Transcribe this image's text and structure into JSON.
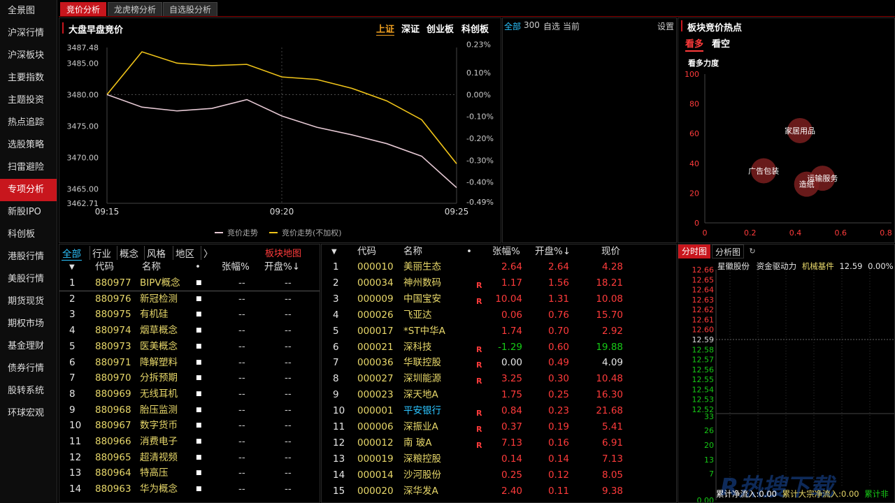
{
  "nav": [
    "全景图",
    "沪深行情",
    "沪深板块",
    "主要指数",
    "主题投资",
    "热点追踪",
    "选股策略",
    "扫雷避险",
    "专项分析",
    "新股IPO",
    "科创板",
    "港股行情",
    "美股行情",
    "期货现货",
    "期权市场",
    "基金理财",
    "债券行情",
    "股转系统",
    "环球宏观"
  ],
  "nav_active": 8,
  "tabs": [
    "竞价分析",
    "龙虎榜分析",
    "自选股分析"
  ],
  "auction": {
    "title": "大盘早盘竞价",
    "markets": [
      "上证",
      "深证",
      "创业板",
      "科创板"
    ],
    "active_market": 0,
    "legend": [
      "竞价走势",
      "竞价走势(不加权)"
    ]
  },
  "mid_toolbar": {
    "all": "全部",
    "count": "300",
    "watch": "自选",
    "current": "当前",
    "settings": "设置"
  },
  "hot": {
    "title": "板块竞价热点",
    "tabs": [
      "看多",
      "看空"
    ],
    "active_tab": 0,
    "subtitle": "看多力度"
  },
  "sector_filters": [
    "全部",
    "行业",
    "概念",
    "风格",
    "地区",
    "〉"
  ],
  "sector_map_label": "板块地图",
  "sector_headers": {
    "code": "代码",
    "name": "名称",
    "dot": "•",
    "change": "张幅%",
    "open": "开盘%↓"
  },
  "sectors": [
    [
      "1",
      "880977",
      "BIPV概念",
      "--",
      "--"
    ],
    [
      "2",
      "880976",
      "新冠检测",
      "--",
      "--"
    ],
    [
      "3",
      "880975",
      "有机硅",
      "--",
      "--"
    ],
    [
      "4",
      "880974",
      "烟草概念",
      "--",
      "--"
    ],
    [
      "5",
      "880973",
      "医美概念",
      "--",
      "--"
    ],
    [
      "6",
      "880971",
      "降解塑料",
      "--",
      "--"
    ],
    [
      "7",
      "880970",
      "分拆预期",
      "--",
      "--"
    ],
    [
      "8",
      "880969",
      "无线耳机",
      "--",
      "--"
    ],
    [
      "9",
      "880968",
      "胎压监测",
      "--",
      "--"
    ],
    [
      "10",
      "880967",
      "数字货币",
      "--",
      "--"
    ],
    [
      "11",
      "880966",
      "消费电子",
      "--",
      "--"
    ],
    [
      "12",
      "880965",
      "超清视频",
      "--",
      "--"
    ],
    [
      "13",
      "880964",
      "特高压",
      "--",
      "--"
    ],
    [
      "14",
      "880963",
      "华为概念",
      "--",
      "--"
    ]
  ],
  "stock_headers": {
    "code": "代码",
    "name": "名称",
    "dot": "•",
    "change": "张幅%",
    "open": "开盘%↓",
    "price": "现价"
  },
  "stocks": [
    {
      "no": "1",
      "code": "000010",
      "name": "美丽生态",
      "r": "",
      "chg": "2.64",
      "open": "2.64",
      "price": "4.28",
      "c": "red",
      "nc": "yellow"
    },
    {
      "no": "2",
      "code": "000034",
      "name": "神州数码",
      "r": "R",
      "chg": "1.17",
      "open": "1.56",
      "price": "18.21",
      "c": "red",
      "nc": "yellow"
    },
    {
      "no": "3",
      "code": "000009",
      "name": "中国宝安",
      "r": "R",
      "chg": "10.04",
      "open": "1.31",
      "price": "10.08",
      "c": "red",
      "nc": "yellow"
    },
    {
      "no": "4",
      "code": "000026",
      "name": "飞亚达",
      "r": "",
      "chg": "0.06",
      "open": "0.76",
      "price": "15.70",
      "c": "red",
      "nc": "yellow"
    },
    {
      "no": "5",
      "code": "000017",
      "name": "*ST中华A",
      "r": "",
      "chg": "1.74",
      "open": "0.70",
      "price": "2.92",
      "c": "red",
      "nc": "yellow"
    },
    {
      "no": "6",
      "code": "000021",
      "name": "深科技",
      "r": "R",
      "chg": "-1.29",
      "open": "0.60",
      "price": "19.88",
      "c": "green",
      "nc": "yellow"
    },
    {
      "no": "7",
      "code": "000036",
      "name": "华联控股",
      "r": "R",
      "chg": "0.00",
      "open": "0.49",
      "price": "4.09",
      "c": "white",
      "nc": "yellow"
    },
    {
      "no": "8",
      "code": "000027",
      "name": "深圳能源",
      "r": "R",
      "chg": "3.25",
      "open": "0.30",
      "price": "10.48",
      "c": "red",
      "nc": "yellow"
    },
    {
      "no": "9",
      "code": "000023",
      "name": "深天地A",
      "r": "",
      "chg": "1.75",
      "open": "0.25",
      "price": "16.30",
      "c": "red",
      "nc": "yellow"
    },
    {
      "no": "10",
      "code": "000001",
      "name": "平安银行",
      "r": "R",
      "chg": "0.84",
      "open": "0.23",
      "price": "21.68",
      "c": "red",
      "nc": "cyan"
    },
    {
      "no": "11",
      "code": "000006",
      "name": "深振业A",
      "r": "R",
      "chg": "0.37",
      "open": "0.19",
      "price": "5.41",
      "c": "red",
      "nc": "yellow"
    },
    {
      "no": "12",
      "code": "000012",
      "name": "南 玻A",
      "r": "R",
      "chg": "7.13",
      "open": "0.16",
      "price": "6.91",
      "c": "red",
      "nc": "yellow"
    },
    {
      "no": "13",
      "code": "000019",
      "name": "深粮控股",
      "r": "",
      "chg": "0.14",
      "open": "0.14",
      "price": "7.13",
      "c": "red",
      "nc": "yellow"
    },
    {
      "no": "14",
      "code": "000014",
      "name": "沙河股份",
      "r": "",
      "chg": "0.25",
      "open": "0.12",
      "price": "8.05",
      "c": "red",
      "nc": "yellow"
    },
    {
      "no": "15",
      "code": "000020",
      "name": "深华发A",
      "r": "",
      "chg": "2.40",
      "open": "0.11",
      "price": "9.38",
      "c": "red",
      "nc": "yellow"
    }
  ],
  "minute": {
    "tabs": [
      "分时图",
      "分析图"
    ],
    "active_tab": 0,
    "stock": "星徽股份",
    "label": "资金驱动力",
    "sector": "机械基件",
    "price": "12.59",
    "pct": "0.00%",
    "footer": [
      "累计净流入:0.00",
      "累计大宗净流入:0.00",
      "累计非"
    ]
  },
  "watermark": "R热搜下载",
  "chart_data": [
    {
      "type": "line",
      "title": "大盘早盘竞价",
      "x": [
        "09:15",
        "09:16",
        "09:17",
        "09:18",
        "09:19",
        "09:20",
        "09:21",
        "09:22",
        "09:23",
        "09:24",
        "09:25"
      ],
      "xticks": [
        "09:15",
        "09:20",
        "09:25"
      ],
      "yticks_left": [
        "3487.48",
        "3485.00",
        "3480.00",
        "3475.00",
        "3470.00",
        "3465.00",
        "3462.71"
      ],
      "yticks_right": [
        "0.23%",
        "0.10%",
        "0.00%",
        "-0.10%",
        "-0.20%",
        "-0.30%",
        "-0.40%",
        "-0.49%"
      ],
      "ylim": [
        3462.71,
        3487.48
      ],
      "series": [
        {
          "name": "竞价走势(不加权)",
          "color": "#f0c419",
          "values": [
            3480.0,
            3486.8,
            3485.0,
            3484.6,
            3484.8,
            3482.8,
            3482.4,
            3481.0,
            3479.0,
            3476.0,
            3469.0
          ]
        },
        {
          "name": "竞价走势",
          "color": "#e6c9d4",
          "values": [
            3480.0,
            3478.0,
            3477.4,
            3477.8,
            3479.2,
            3476.6,
            3474.8,
            3473.6,
            3472.2,
            3470.2,
            3465.2
          ]
        }
      ]
    },
    {
      "type": "scatter",
      "title": "看多力度",
      "xlim": [
        0,
        0.8
      ],
      "ylim": [
        0,
        100
      ],
      "xticks": [
        "0",
        "0.2",
        "0.4",
        "0.6",
        "0.8"
      ],
      "yticks": [
        "0",
        "20",
        "40",
        "60",
        "80",
        "100"
      ],
      "points": [
        {
          "label": "家居用品",
          "x": 0.42,
          "y": 62
        },
        {
          "label": "广告包装",
          "x": 0.26,
          "y": 35
        },
        {
          "label": "造纸",
          "x": 0.45,
          "y": 26
        },
        {
          "label": "运输服务",
          "x": 0.52,
          "y": 30
        }
      ]
    },
    {
      "type": "line",
      "title": "分时图",
      "yticks_price": [
        "12.66",
        "12.65",
        "12.64",
        "12.63",
        "12.62",
        "12.61",
        "12.60",
        "12.59",
        "12.58",
        "12.57",
        "12.56",
        "12.55",
        "12.54",
        "12.53",
        "12.52"
      ],
      "yticks_volume": [
        "33",
        "26",
        "20",
        "13",
        "7",
        "0.00"
      ]
    }
  ]
}
